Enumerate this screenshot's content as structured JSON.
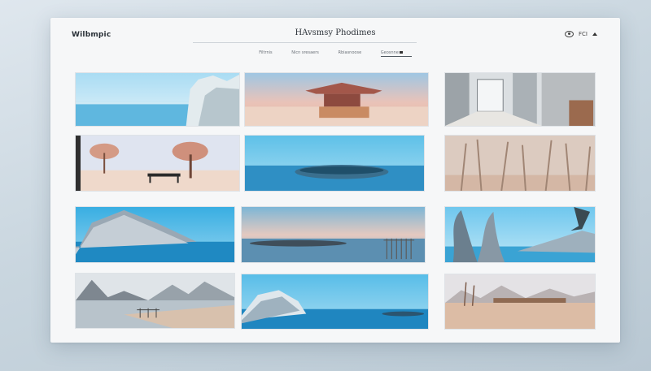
{
  "app": {
    "brand": "Wilbmpic",
    "title": "HAvsmsy Phodimes"
  },
  "header_icons": [
    "eye-icon",
    "chevron-up-icon"
  ],
  "header_text": "FCI",
  "nav": {
    "items": [
      "Filtrnis",
      "Nicn sresaers",
      "Rbiasnoose",
      "Geosnne"
    ],
    "selected_index": 3
  },
  "gallery": {
    "rows": 4,
    "columns": 3,
    "items": [
      {
        "name": "glacier-cliff-lake",
        "scene": "glacier"
      },
      {
        "name": "pavilion-desert-sunset",
        "scene": "pavilion"
      },
      {
        "name": "modern-corridor-interior",
        "scene": "corridor"
      },
      {
        "name": "bench-under-pink-trees",
        "scene": "trees-bench"
      },
      {
        "name": "blue-lake-island",
        "scene": "island"
      },
      {
        "name": "misty-bare-forest",
        "scene": "forest"
      },
      {
        "name": "rock-mountain-water",
        "scene": "rock"
      },
      {
        "name": "pier-at-dusk",
        "scene": "pier"
      },
      {
        "name": "twisted-tree-lake",
        "scene": "twisted"
      },
      {
        "name": "volcano-shoreline",
        "scene": "volcano"
      },
      {
        "name": "snowy-hill-lake",
        "scene": "snowhill"
      },
      {
        "name": "desert-mountain-plain",
        "scene": "desert"
      }
    ]
  },
  "colors": {
    "window": "#f6f7f8",
    "sky_blue": "#7fc4e6",
    "water": "#4aa9d8",
    "sand": "#d8b9a3"
  }
}
